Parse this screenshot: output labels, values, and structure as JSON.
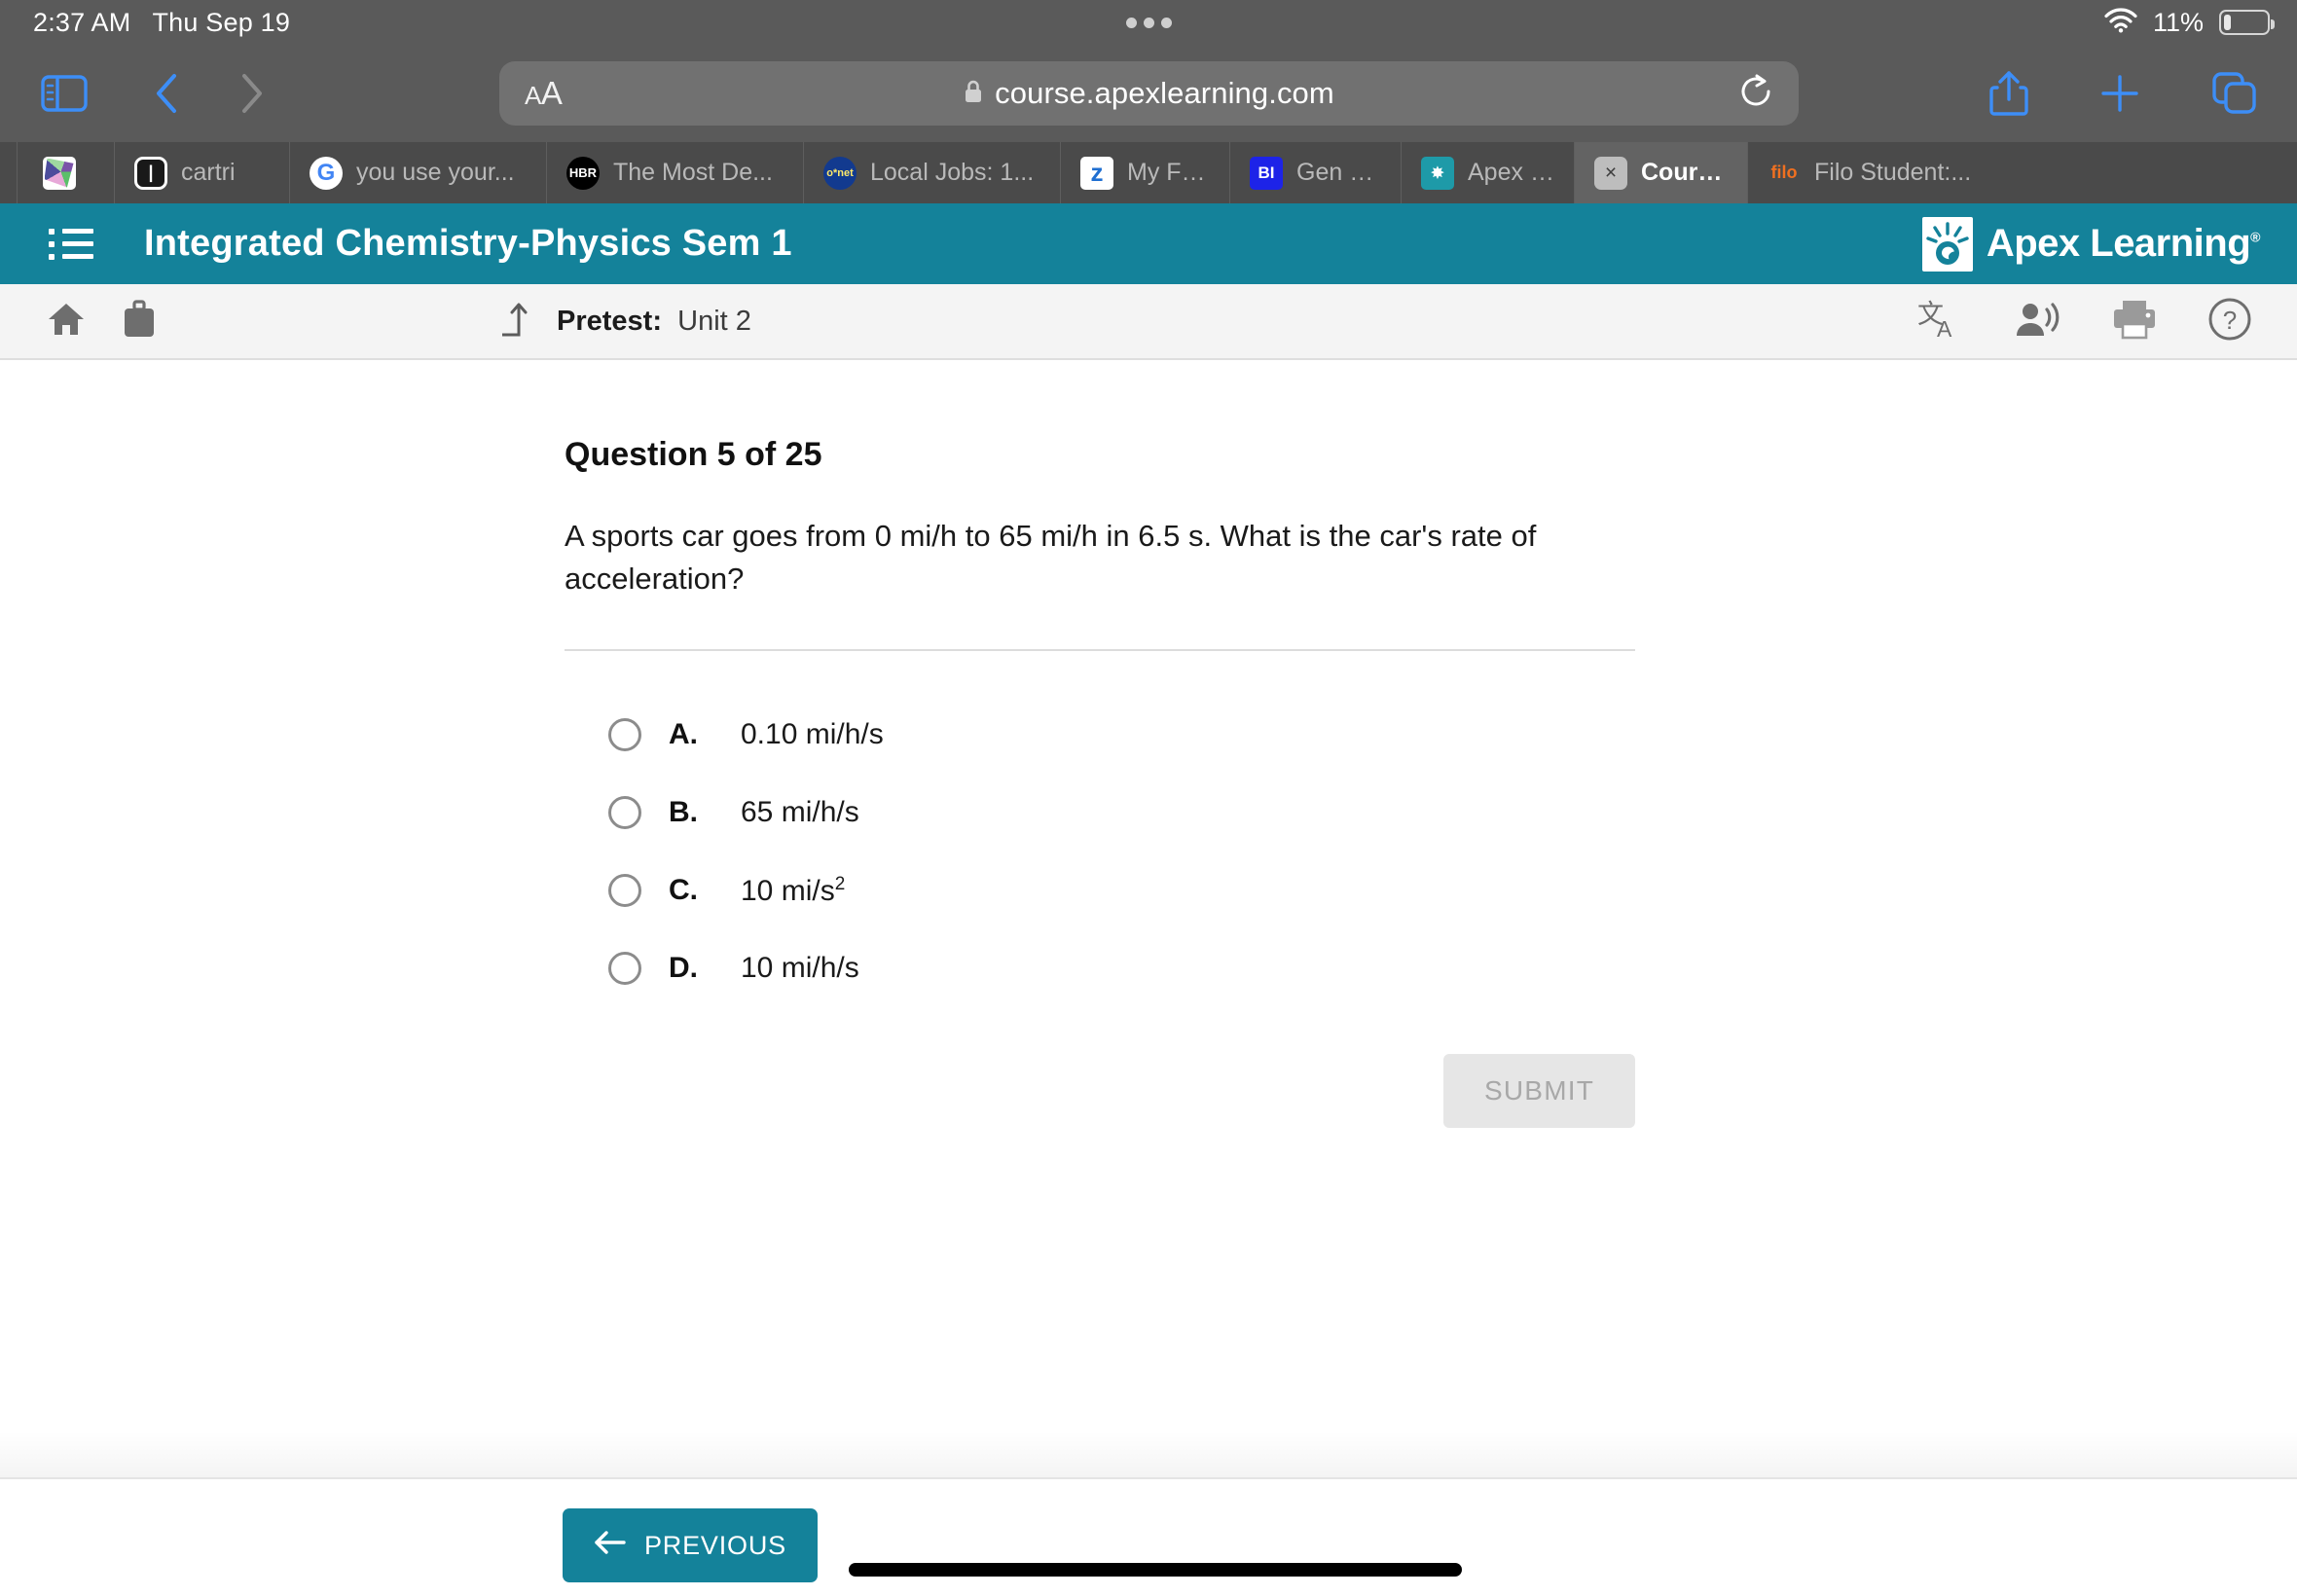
{
  "statusbar": {
    "time": "2:37 AM",
    "date": "Thu Sep 19",
    "battery_percent": "11%",
    "wifi_icon": "wifi-icon",
    "battery_icon": "battery-icon"
  },
  "browser": {
    "sidebar_icon": "sidebar-toggle-icon",
    "back_icon": "chevron-left-icon",
    "forward_icon": "chevron-right-icon",
    "text_size_label": "AA",
    "lock_icon": "lock-icon",
    "url": "course.apexlearning.com",
    "reload_icon": "reload-icon",
    "share_icon": "share-icon",
    "new_tab_icon": "plus-icon",
    "tabs_overview_icon": "tabs-overview-icon",
    "accent_color": "#3d8ef7",
    "chrome_color": "#5a5a5a"
  },
  "tabs": [
    {
      "label": "",
      "favicon": "gallery-image-favicon",
      "active": false
    },
    {
      "label": "cartri",
      "favicon": "letter-i-favicon",
      "active": false
    },
    {
      "label": "you use your...",
      "favicon": "google-favicon",
      "active": false
    },
    {
      "label": "The Most De...",
      "favicon": "hbr-favicon",
      "active": false
    },
    {
      "label": "Local Jobs: 1...",
      "favicon": "onet-favicon",
      "active": false
    },
    {
      "label": "My Favorite...",
      "favicon": "zillow-favicon",
      "active": false
    },
    {
      "label": "Gen Z: Major...",
      "favicon": "business-insider-favicon",
      "active": false
    },
    {
      "label": "Apex Learning",
      "favicon": "apex-learning-favicon",
      "active": false
    },
    {
      "label": "Courses",
      "favicon": "close-tab-icon",
      "active": true
    },
    {
      "label": "Filo Student:...",
      "favicon": "filo-favicon",
      "active": false
    }
  ],
  "app_header": {
    "menu_icon": "hamburger-menu-icon",
    "course_title": "Integrated Chemistry-Physics Sem 1",
    "brand_name": "Apex Learning",
    "brand_trademark": "®",
    "brand_logo_icon": "apex-learning-logo-icon",
    "teal": "#14829a"
  },
  "subbar": {
    "home_icon": "home-icon",
    "briefcase_icon": "briefcase-icon",
    "up_arrow_icon": "arrow-up-level-icon",
    "crumb_type": "Pretest:",
    "crumb_unit": "Unit 2",
    "translate_icon": "translate-icon",
    "read-aloud_icon": "read-aloud-icon",
    "print_icon": "print-icon",
    "help_icon": "help-icon"
  },
  "question": {
    "heading": "Question 5 of 25",
    "prompt": "A sports car goes from 0 mi/h to 65 mi/h in 6.5 s. What is the car's rate of acceleration?",
    "options": [
      {
        "letter": "A.",
        "text": "0.10 mi/h/s",
        "exponent": "",
        "selected": false
      },
      {
        "letter": "B.",
        "text": "65 mi/h/s",
        "exponent": "",
        "selected": false
      },
      {
        "letter": "C.",
        "text": "10 mi/s",
        "exponent": "2",
        "selected": false
      },
      {
        "letter": "D.",
        "text": "10 mi/h/s",
        "exponent": "",
        "selected": false
      }
    ],
    "submit_label": "SUBMIT",
    "submit_disabled": true
  },
  "footer": {
    "previous_label": "PREVIOUS",
    "previous_arrow_icon": "arrow-left-icon",
    "home_indicator_icon": "home-indicator"
  }
}
